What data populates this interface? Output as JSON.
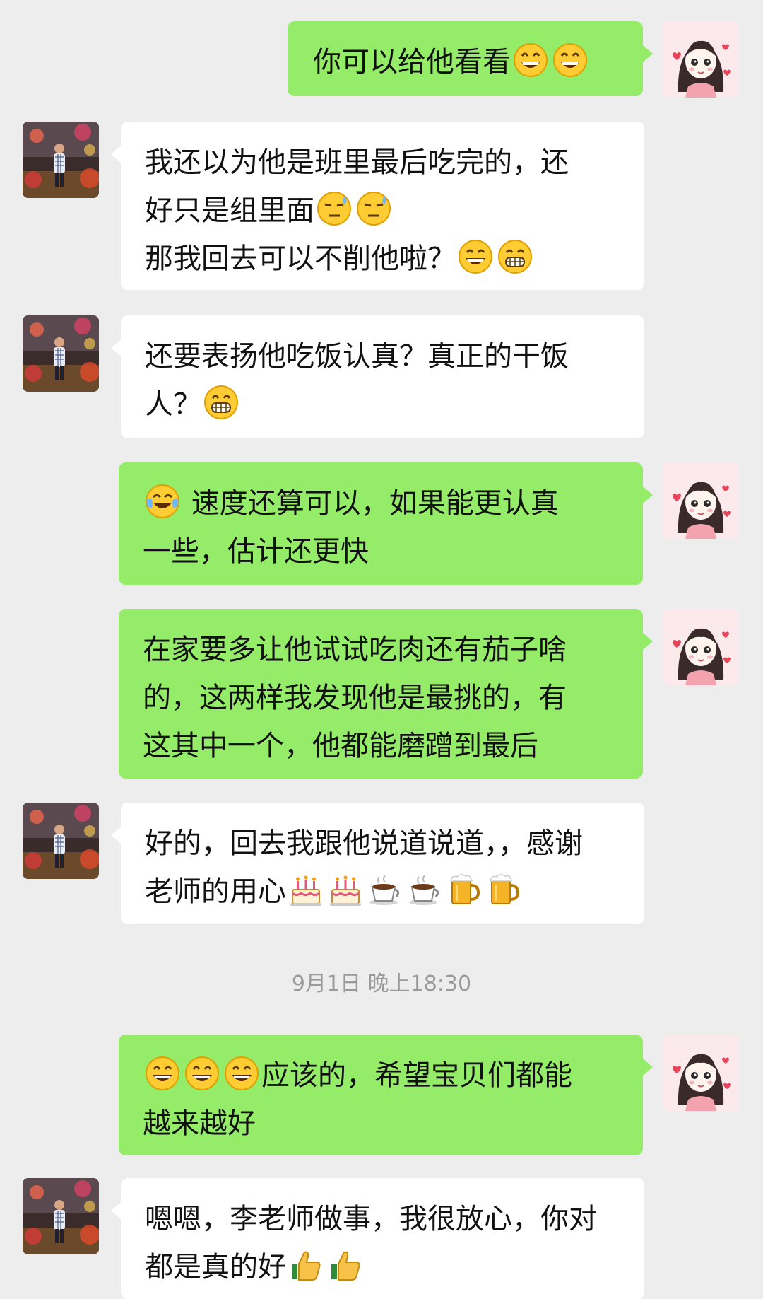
{
  "chat": {
    "timestamp": "9月1日 晚上18:30",
    "messages": [
      {
        "sender": "teacher",
        "lines": [
          "你可以给他看看"
        ]
      },
      {
        "sender": "parent",
        "lines": [
          "我还以为他是班里最后吃完的，还",
          "好只是组里面",
          "那我回去可以不削他啦？"
        ]
      },
      {
        "sender": "parent",
        "lines": [
          "还要表扬他吃饭认真？真正的干饭",
          "人？"
        ]
      },
      {
        "sender": "teacher",
        "lines": [
          "速度还算可以，如果能更认真",
          "一些，估计还更快"
        ]
      },
      {
        "sender": "teacher",
        "lines": [
          "在家要多让他试试吃肉还有茄子啥",
          "的，这两样我发现他是最挑的，有",
          "这其中一个，他都能磨蹭到最后"
        ]
      },
      {
        "sender": "parent",
        "lines": [
          "好的，回去我跟他说道说道，，感谢",
          "老师的用心"
        ]
      },
      {
        "sender": "teacher",
        "lines": [
          "应该的，希望宝贝们都能",
          "越来越好"
        ]
      },
      {
        "sender": "parent",
        "lines": [
          "嗯嗯，李老师做事，我很放心，你对",
          "都是真的好"
        ]
      }
    ]
  },
  "icons": {
    "grin": "grinning-face-emoji",
    "sweat": "downcast-face-with-sweat-emoji",
    "beam": "beaming-face-emoji",
    "joy": "face-with-tears-of-joy-emoji",
    "cake": "birthday-cake-emoji",
    "coffee": "hot-beverage-emoji",
    "beer": "beer-mug-emoji",
    "thumb": "thumbs-up-emoji"
  },
  "colors": {
    "background": "#ededed",
    "outgoing_bubble": "#95ec69",
    "incoming_bubble": "#ffffff",
    "timestamp_text": "#9a9a9a"
  }
}
